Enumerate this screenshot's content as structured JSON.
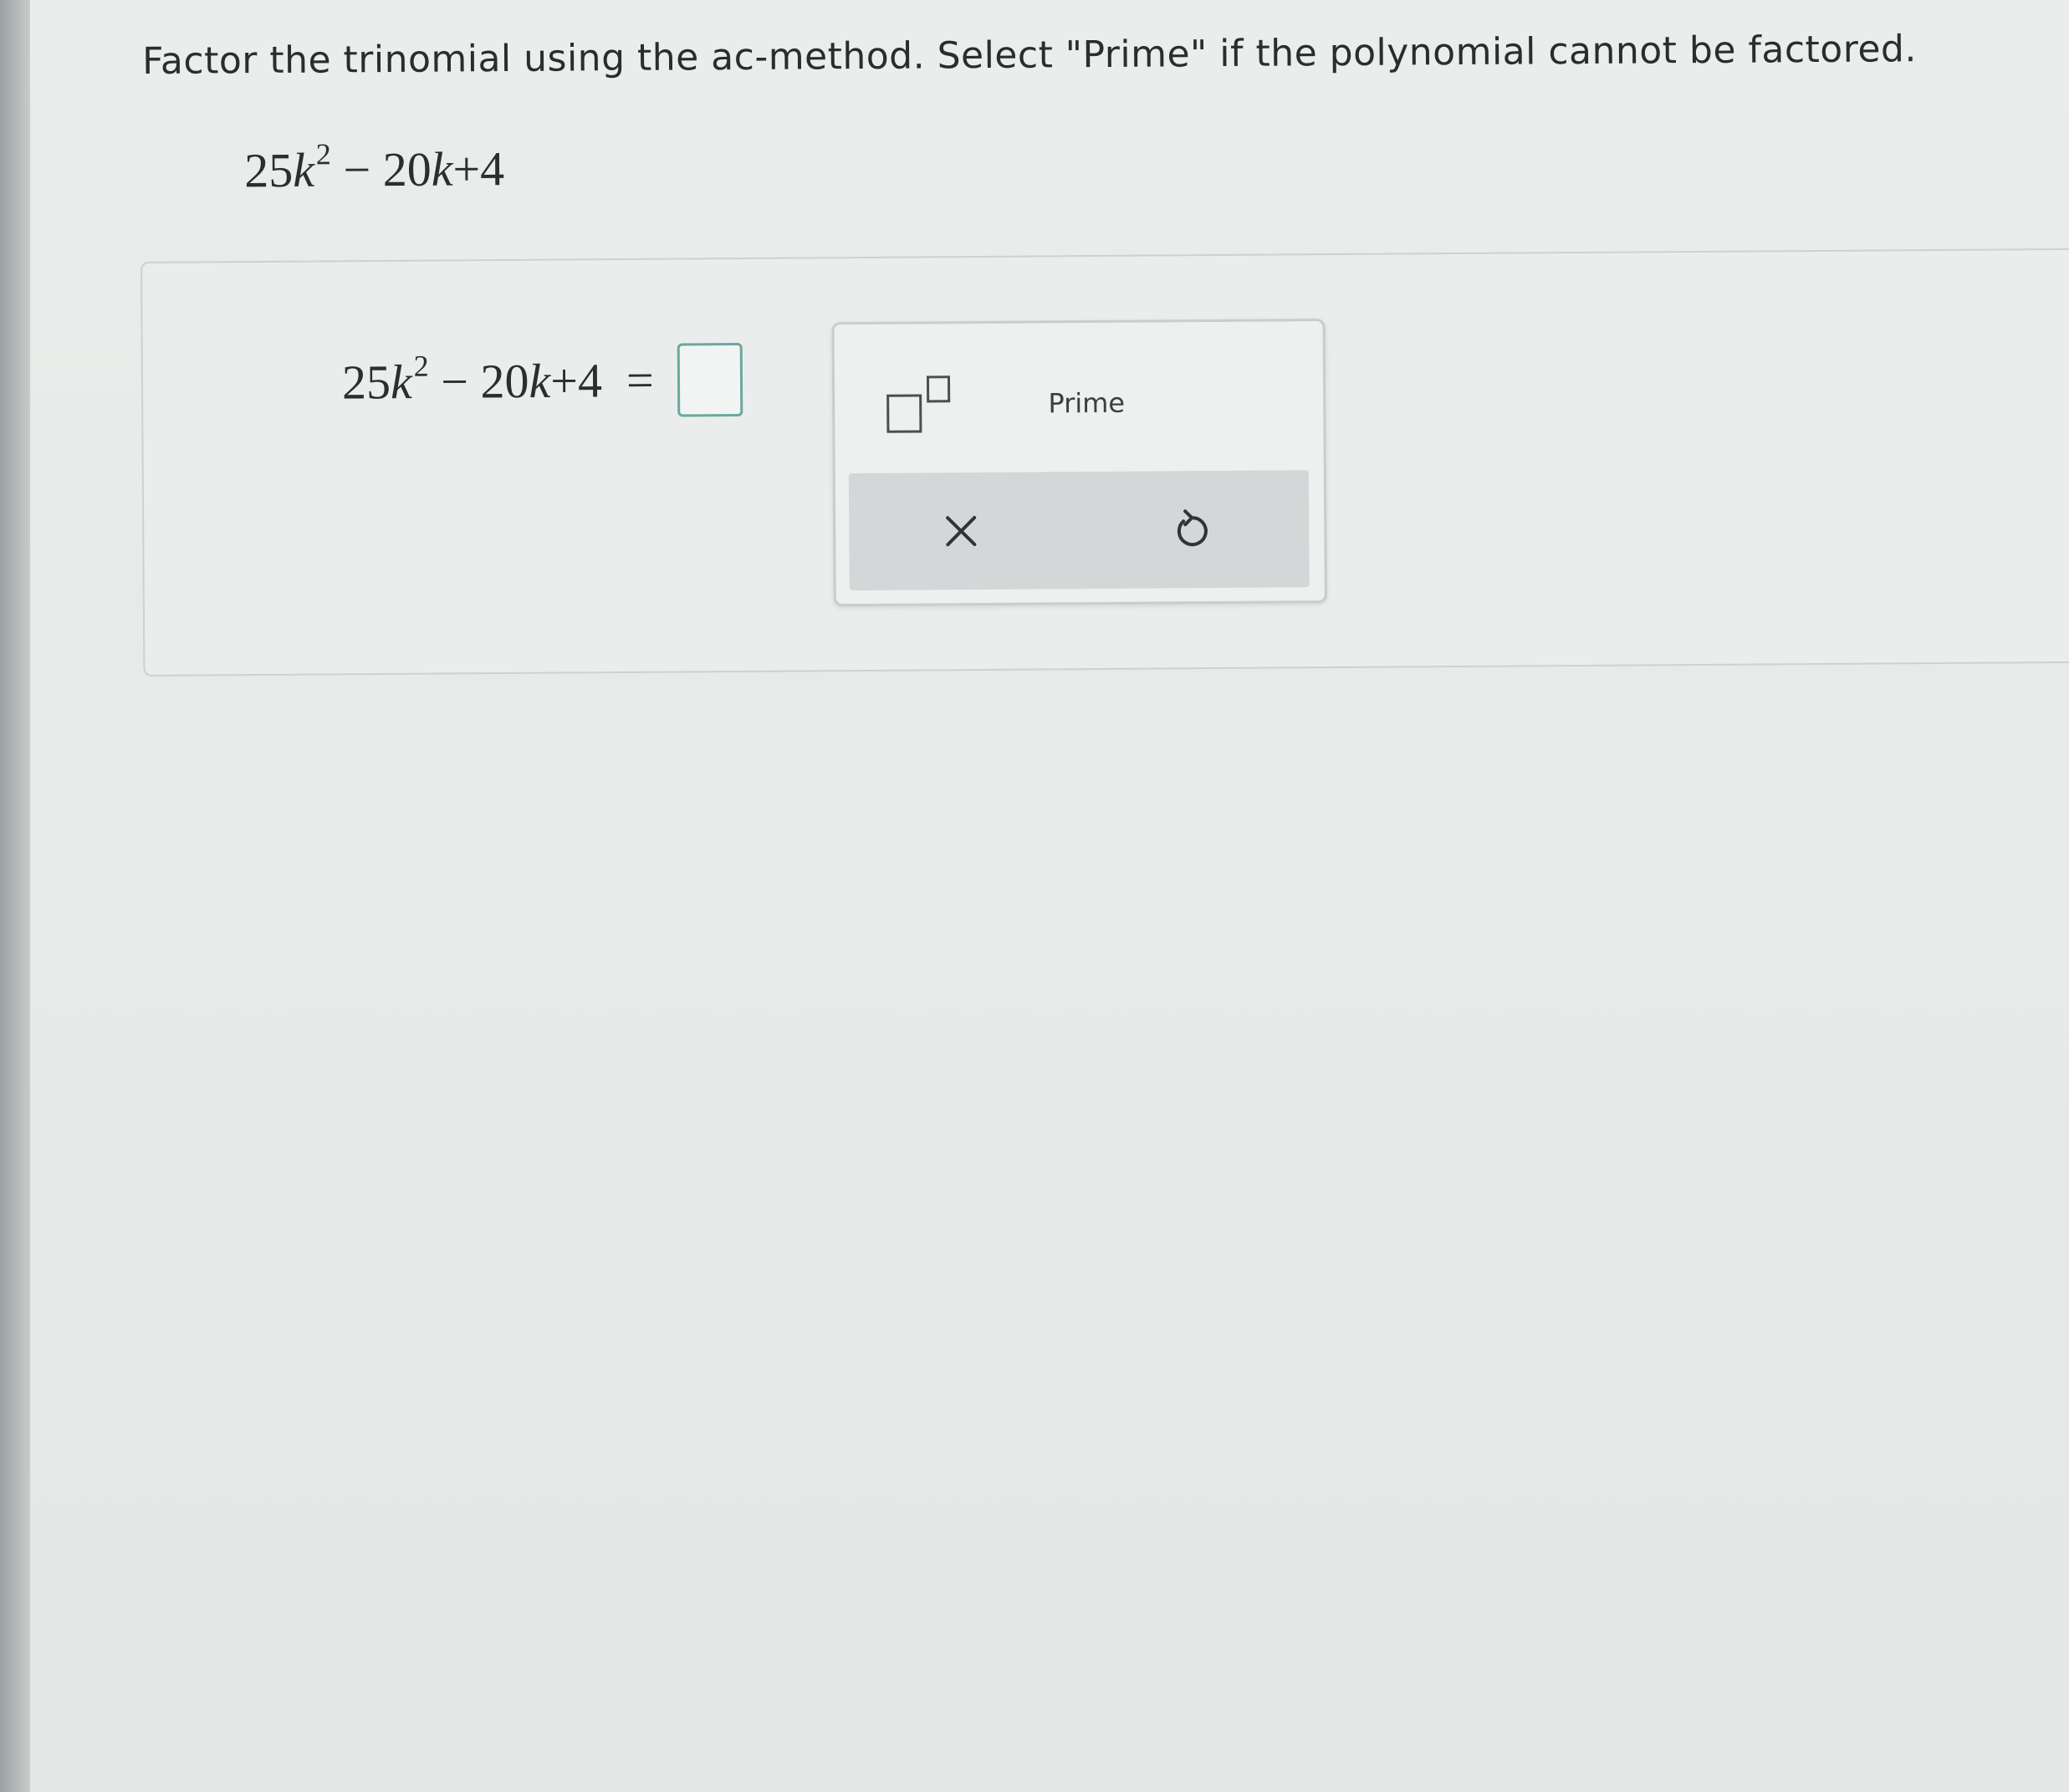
{
  "problem": {
    "instruction": "Factor the trinomial using the ac-method. Select \"Prime\" if the polynomial cannot be factored.",
    "expression": {
      "coef1": "25",
      "var": "k",
      "exp": "2",
      "op1": "−",
      "coef2": "20",
      "op2": "+",
      "const": "4"
    }
  },
  "answer": {
    "equals": "="
  },
  "keypad": {
    "prime_label": "Prime"
  },
  "colors": {
    "answer_box_border": "#6aa8a0",
    "action_bar": "#d3d7d7"
  },
  "icons": {
    "exponent": "exponent-template-icon",
    "clear": "close-icon",
    "undo": "undo-icon"
  }
}
